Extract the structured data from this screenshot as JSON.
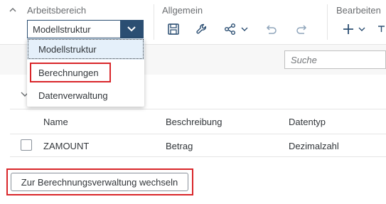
{
  "toolbar": {
    "groups": [
      {
        "title": "Arbeitsbereich"
      },
      {
        "title": "Allgemein"
      },
      {
        "title": "Bearbeiten"
      }
    ],
    "workspace_select": {
      "value": "Modellstruktur"
    },
    "icons": [
      "save-icon",
      "wrench-icon",
      "share-icon",
      "chevron-down-icon",
      "undo-icon",
      "redo-icon",
      "add-icon",
      "chevron-down-icon"
    ]
  },
  "search": {
    "placeholder": "Suche"
  },
  "dropdown": {
    "items": [
      {
        "label": "Modellstruktur",
        "selected": true
      },
      {
        "label": "Berechnungen",
        "highlighted": true
      },
      {
        "label": "Datenverwaltung"
      }
    ]
  },
  "table": {
    "columns": [
      "Name",
      "Beschreibung",
      "Datentyp"
    ],
    "rows": [
      {
        "name": "ZAMOUNT",
        "description": "Betrag",
        "datatype": "Dezimalzahl",
        "checked": false
      }
    ]
  },
  "action": {
    "label": "Zur Berechnungsverwaltung wechseln"
  },
  "colors": {
    "accent": "#2b4e72",
    "highlight": "#d9262a",
    "selected_bg": "#e5f0fa"
  }
}
